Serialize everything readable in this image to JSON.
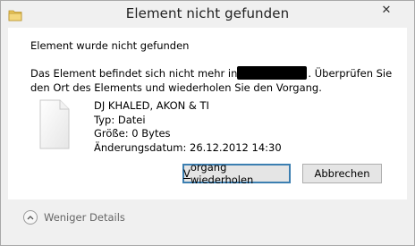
{
  "window": {
    "title": "Element nicht gefunden",
    "close_glyph": "✕"
  },
  "dialog": {
    "heading": "Element wurde nicht gefunden",
    "message_before": "Das Element befindet sich nicht mehr in",
    "message_after": ". Überprüfen Sie den Ort des Elements und wiederholen Sie den Vorgang."
  },
  "file": {
    "name": "DJ KHALED, AKON & TI",
    "type": "Typ: Datei",
    "size": "Größe: 0 Bytes",
    "modified": "Änderungsdatum: 26.12.2012 14:30"
  },
  "buttons": {
    "retry_prefix": "V",
    "retry_rest": "organg wiederholen",
    "cancel": "Abbrechen"
  },
  "footer": {
    "details_label": "Weniger Details"
  },
  "icons": {
    "title": "folder-icon",
    "file": "file-icon",
    "toggle": "chevron-up-icon"
  }
}
